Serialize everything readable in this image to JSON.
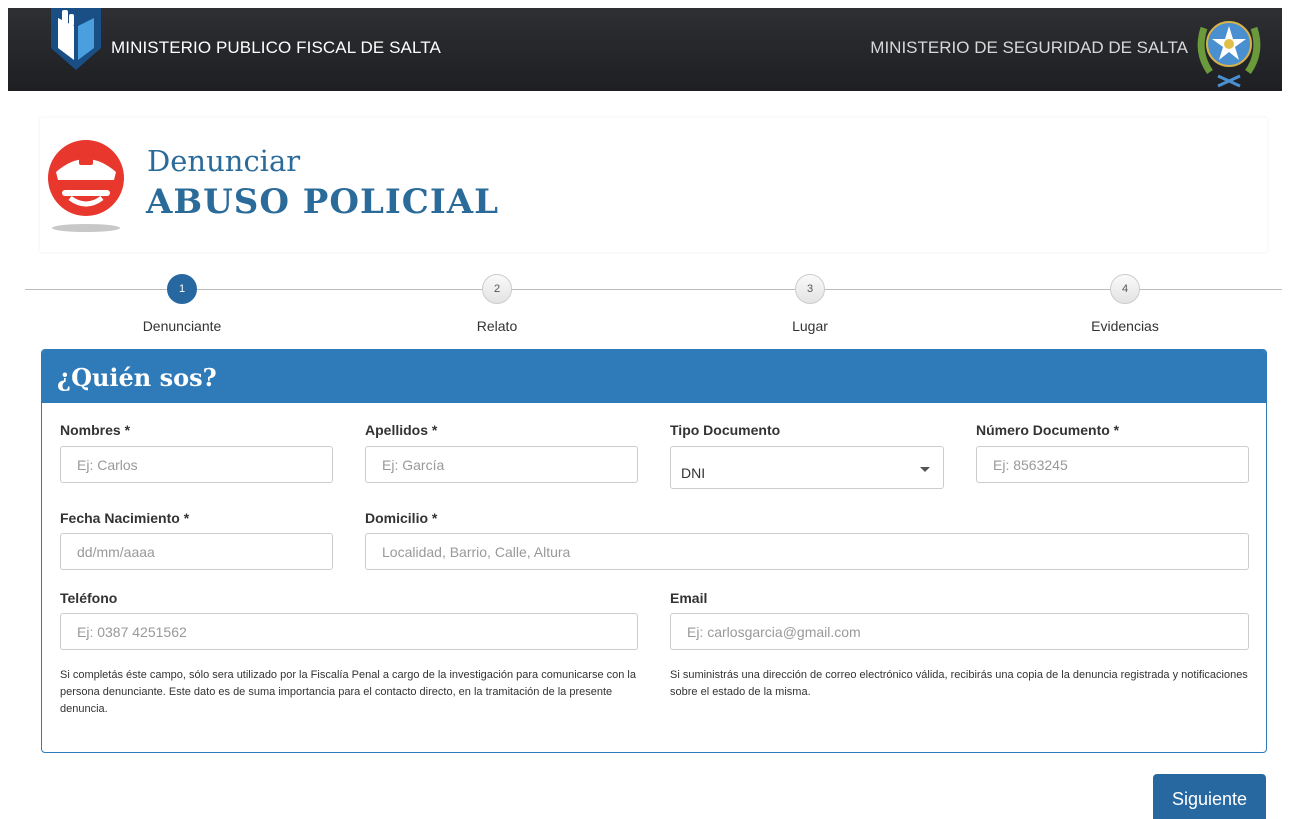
{
  "topbar": {
    "left_title": "MINISTERIO PUBLICO FISCAL DE SALTA",
    "right_title": "MINISTERIO DE SEGURIDAD DE SALTA",
    "background": "#24262a"
  },
  "header": {
    "line1": "Denunciar",
    "line2": "ABUSO POLICIAL",
    "color": "#2b6b9a",
    "icon": "police-officer-icon"
  },
  "stepper": {
    "steps": [
      {
        "number": "1",
        "label": "Denunciante",
        "active": true
      },
      {
        "number": "2",
        "label": "Relato",
        "active": false
      },
      {
        "number": "3",
        "label": "Lugar",
        "active": false
      },
      {
        "number": "4",
        "label": "Evidencias",
        "active": false
      }
    ]
  },
  "form": {
    "title": "¿Quién sos?",
    "accent": "#2f7ab8",
    "nombres": {
      "label": "Nombres *",
      "placeholder": "Ej: Carlos"
    },
    "apellidos": {
      "label": "Apellidos *",
      "placeholder": "Ej: García"
    },
    "tipo_documento": {
      "label": "Tipo Documento",
      "value": "DNI"
    },
    "numero_documento": {
      "label": "Número Documento *",
      "placeholder": "Ej: 8563245"
    },
    "fecha_nacimiento": {
      "label": "Fecha Nacimiento *",
      "placeholder": "dd/mm/aaaa"
    },
    "domicilio": {
      "label": "Domicilio *",
      "placeholder": "Localidad, Barrio, Calle, Altura"
    },
    "telefono": {
      "label": "Teléfono",
      "placeholder": "Ej: 0387 4251562",
      "help": "Si completás éste campo, sólo sera utilizado por la Fiscalía Penal a cargo de la investigación para comunicarse con la persona denunciante. Este dato es de suma importancia para el contacto directo, en la tramitación de la presente denuncia."
    },
    "email": {
      "label": "Email",
      "placeholder": "Ej: carlosgarcia@gmail.com",
      "help": "Si suministrás una dirección de correo electrónico válida, recibirás una copia de la denuncia registrada y notificaciones sobre el estado de la misma."
    }
  },
  "actions": {
    "next_label": "Siguiente"
  }
}
